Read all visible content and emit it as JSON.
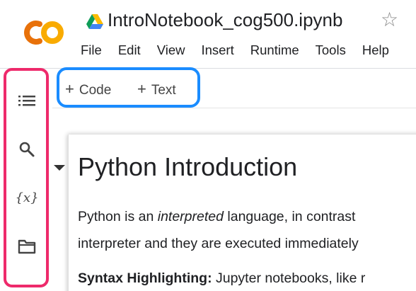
{
  "header": {
    "logo_text": "CO",
    "notebook_title": "IntroNotebook_cog500.ipynb",
    "star_glyph": "☆",
    "menu": [
      "File",
      "Edit",
      "View",
      "Insert",
      "Runtime",
      "Tools",
      "Help"
    ]
  },
  "sidebar": {
    "items": [
      {
        "name": "table-of-contents",
        "icon": "list-icon"
      },
      {
        "name": "search",
        "icon": "search-icon"
      },
      {
        "name": "variables",
        "icon": "variables-icon",
        "glyph": "{x}"
      },
      {
        "name": "files",
        "icon": "folder-icon"
      }
    ]
  },
  "toolbar": {
    "code_label": "Code",
    "text_label": "Text",
    "plus": "+"
  },
  "cell": {
    "heading": "Python Introduction",
    "para1_a": "Python is an ",
    "para1_em": "interpreted",
    "para1_b": " language, in contrast",
    "para2": "interpreter and they are executed immediately",
    "para3_bold": "Syntax Highlighting:",
    "para3_rest": " Jupyter notebooks, like r"
  },
  "colors": {
    "sidebar_highlight": "#ee2a6b",
    "toolbar_highlight": "#1a8cff",
    "logo_orange": "#f9ab00",
    "logo_dark_orange": "#e8710a"
  }
}
